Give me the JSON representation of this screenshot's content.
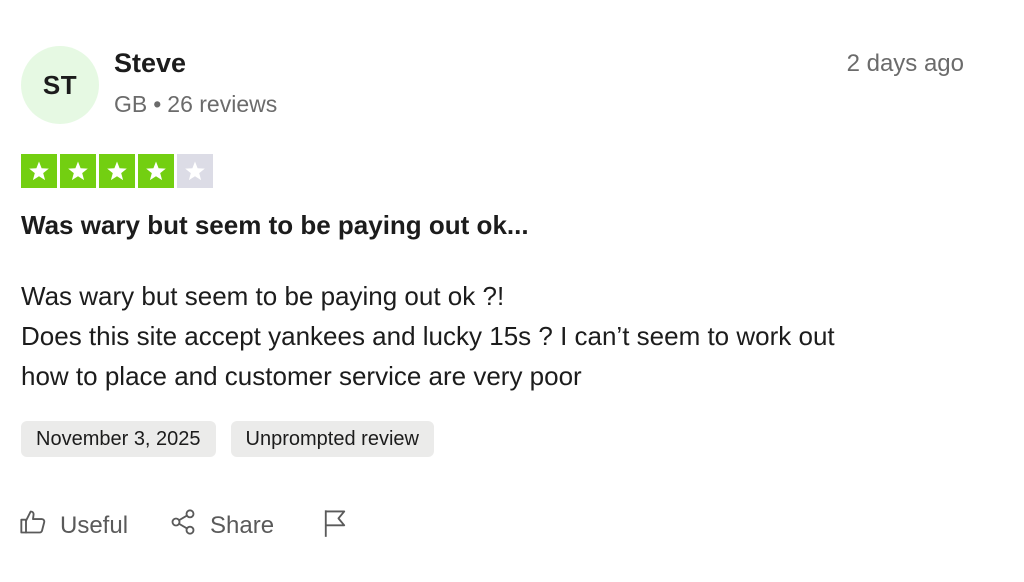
{
  "reviewer": {
    "initials": "ST",
    "name": "Steve",
    "country": "GB",
    "separator": "•",
    "review_count": "26 reviews",
    "avatar_color": "#e6f9e3"
  },
  "posted_relative": "2 days ago",
  "rating": {
    "value": 4,
    "max": 5,
    "filled_color": "#73cf11",
    "empty_color": "#dcdce6",
    "icon": "star-icon"
  },
  "review": {
    "title": "Was wary but seem to be paying out ok...",
    "body_lines": [
      "Was wary but seem to be paying out ok ?!",
      "Does this site accept yankees and lucky 15s ? I can’t seem to work out",
      "how to place and customer service are very poor"
    ]
  },
  "tags": {
    "date": "November 3, 2025",
    "type": "Unprompted review"
  },
  "actions": {
    "useful": {
      "label": "Useful",
      "icon": "thumbs-up-icon"
    },
    "share": {
      "label": "Share",
      "icon": "share-icon"
    },
    "report": {
      "icon": "flag-icon"
    }
  }
}
